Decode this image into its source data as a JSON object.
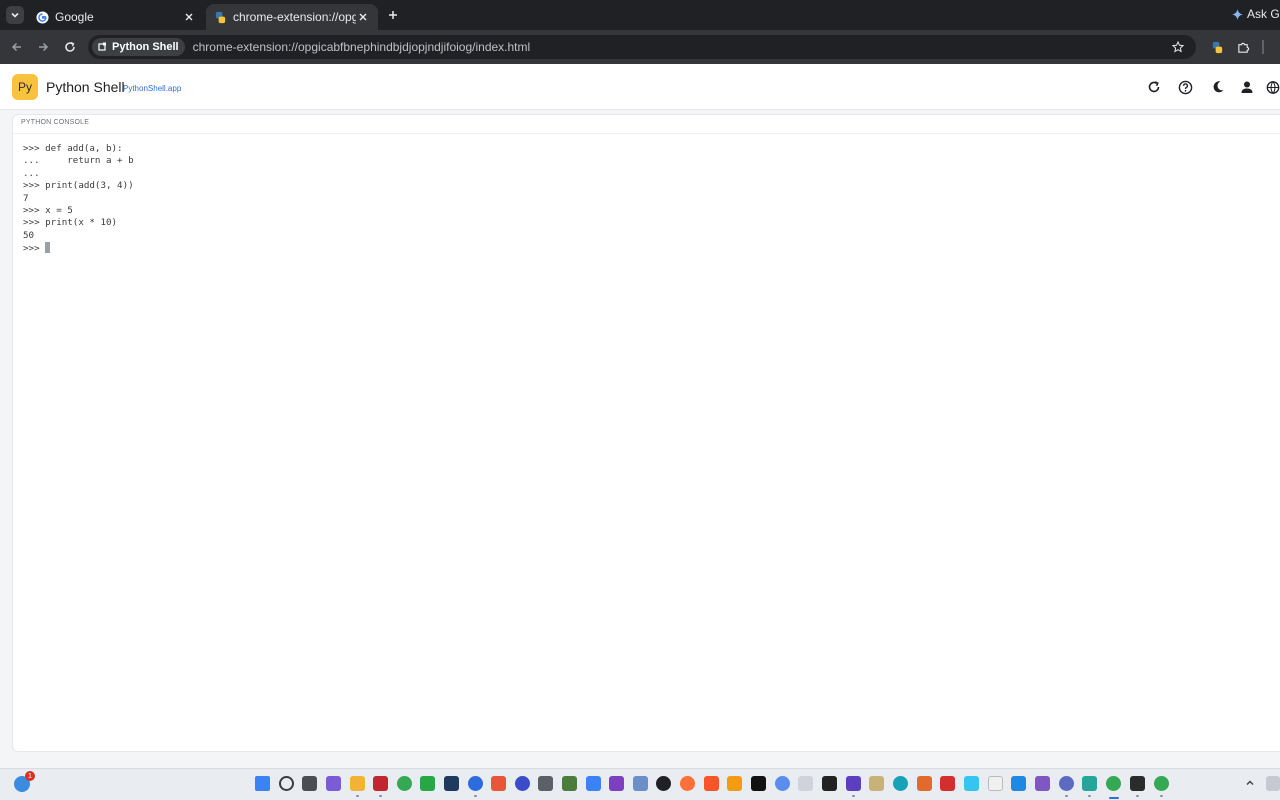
{
  "browser": {
    "tabs": [
      {
        "title": "Google",
        "active": false
      },
      {
        "title": "chrome-extension://opgicabfbn",
        "active": true
      }
    ],
    "ask_gemini": "Ask Gem",
    "site_chip": "Python Shell",
    "url": "chrome-extension://opgicabfbnephindbjdjopjndjifoiog/index.html"
  },
  "app": {
    "logo_text": "Py",
    "title": "Python Shell",
    "link": "PythonShell.app",
    "header_icons": [
      "refresh-icon",
      "help-icon",
      "dark-mode-icon",
      "account-icon",
      "language-icon"
    ]
  },
  "console": {
    "label": "PYTHON CONSOLE",
    "lines": [
      ">>> def add(a, b):",
      "...     return a + b",
      "...",
      ">>> print(add(3, 4))",
      "7",
      ">>> x = 5",
      ">>> print(x * 10)",
      "50"
    ],
    "prompt": ">>>"
  },
  "taskbar": {
    "notification_count": "1",
    "accent": "#2f6fd6"
  }
}
